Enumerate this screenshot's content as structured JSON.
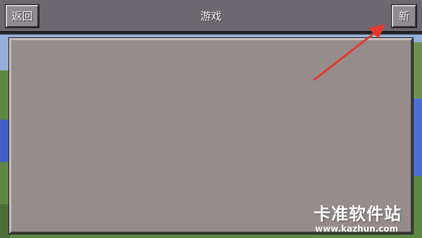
{
  "header": {
    "back_label": "返回",
    "title": "游戏",
    "new_label": "新"
  },
  "watermark": {
    "name": "卡准软件站",
    "url": "www.kazhun.com"
  },
  "colors": {
    "topbar": "#6d6870",
    "button_face": "#8f8b90",
    "panel": "#978c8c",
    "arrow": "#e3382c"
  }
}
